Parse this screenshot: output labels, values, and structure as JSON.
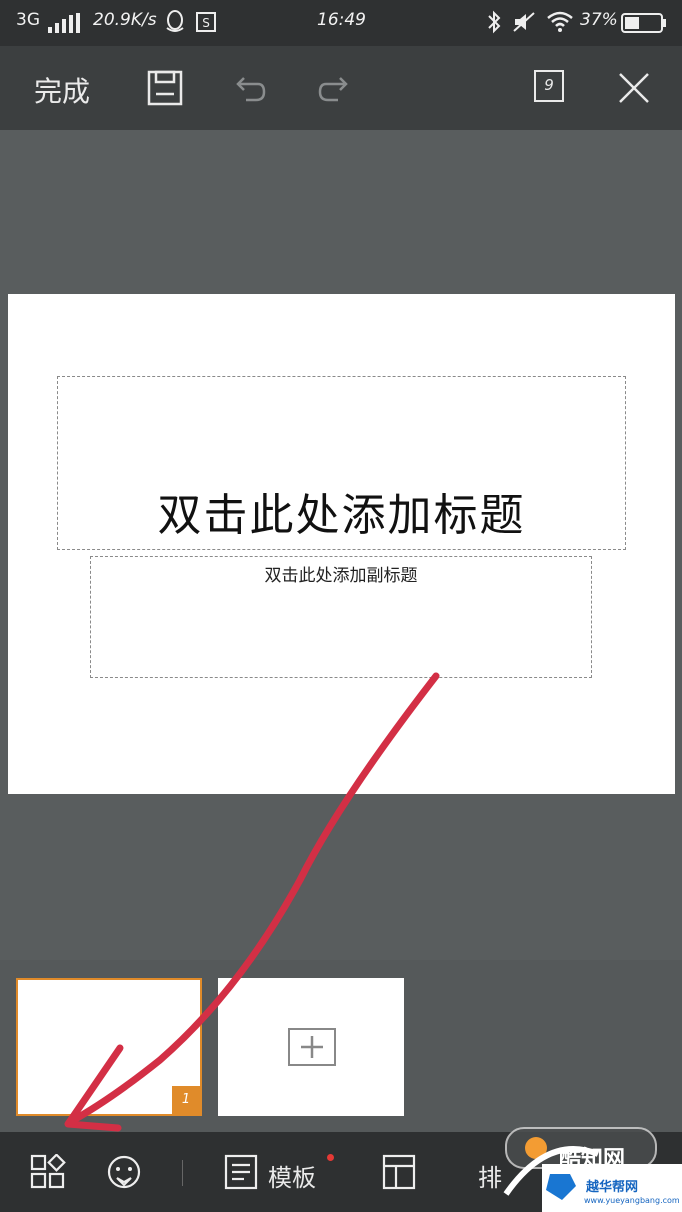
{
  "status_bar": {
    "network": "3G",
    "speed": "20.9K/s",
    "time": "16:49",
    "battery": "37%"
  },
  "toolbar": {
    "done_label": "完成",
    "page_count": "9"
  },
  "slide": {
    "title_placeholder": "双击此处添加标题",
    "subtitle_placeholder": "双击此处添加副标题"
  },
  "thumbnails": {
    "slide_number": "1"
  },
  "bottom_bar": {
    "template_label": "模板",
    "layout_label": "排"
  },
  "watermark": {
    "site_name": "酷知网",
    "site_name2": "越华帮网",
    "url": "www.yueyangbang.com"
  },
  "colors": {
    "accent": "#e08b2a",
    "annotation": "#d32f45",
    "notification_dot": "#e53935"
  }
}
